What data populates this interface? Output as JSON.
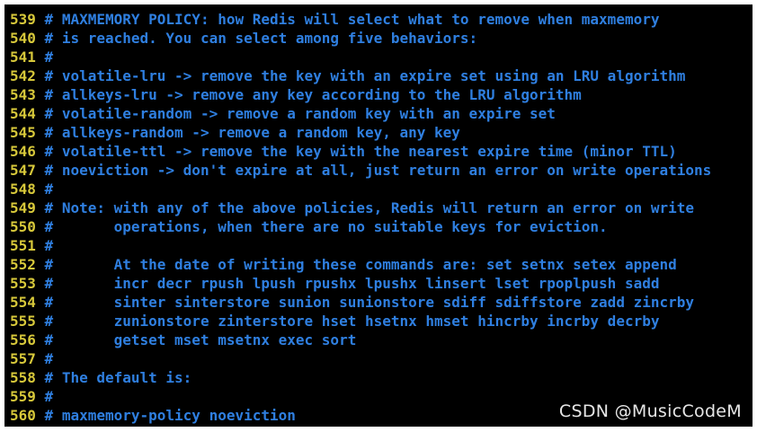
{
  "editor": {
    "lines": [
      {
        "number": "539",
        "text": "# MAXMEMORY POLICY: how Redis will select what to remove when maxmemory"
      },
      {
        "number": "540",
        "text": "# is reached. You can select among five behaviors:"
      },
      {
        "number": "541",
        "text": "#"
      },
      {
        "number": "542",
        "text": "# volatile-lru -> remove the key with an expire set using an LRU algorithm"
      },
      {
        "number": "543",
        "text": "# allkeys-lru -> remove any key according to the LRU algorithm"
      },
      {
        "number": "544",
        "text": "# volatile-random -> remove a random key with an expire set"
      },
      {
        "number": "545",
        "text": "# allkeys-random -> remove a random key, any key"
      },
      {
        "number": "546",
        "text": "# volatile-ttl -> remove the key with the nearest expire time (minor TTL)"
      },
      {
        "number": "547",
        "text": "# noeviction -> don't expire at all, just return an error on write operations"
      },
      {
        "number": "548",
        "text": "#"
      },
      {
        "number": "549",
        "text": "# Note: with any of the above policies, Redis will return an error on write"
      },
      {
        "number": "550",
        "text": "#       operations, when there are no suitable keys for eviction."
      },
      {
        "number": "551",
        "text": "#"
      },
      {
        "number": "552",
        "text": "#       At the date of writing these commands are: set setnx setex append"
      },
      {
        "number": "553",
        "text": "#       incr decr rpush lpush rpushx lpushx linsert lset rpoplpush sadd"
      },
      {
        "number": "554",
        "text": "#       sinter sinterstore sunion sunionstore sdiff sdiffstore zadd zincrby"
      },
      {
        "number": "555",
        "text": "#       zunionstore zinterstore hset hsetnx hmset hincrby incrby decrby"
      },
      {
        "number": "556",
        "text": "#       getset mset msetnx exec sort"
      },
      {
        "number": "557",
        "text": "#"
      },
      {
        "number": "558",
        "text": "# The default is:"
      },
      {
        "number": "559",
        "text": "#"
      },
      {
        "number": "560",
        "text": "# maxmemory-policy noeviction"
      }
    ]
  },
  "watermark": "CSDN @MusicCodeM",
  "colors": {
    "background": "#000000",
    "line_number": "#d7c83a",
    "comment": "#2f7fe0",
    "watermark": "#e6e6e6"
  }
}
